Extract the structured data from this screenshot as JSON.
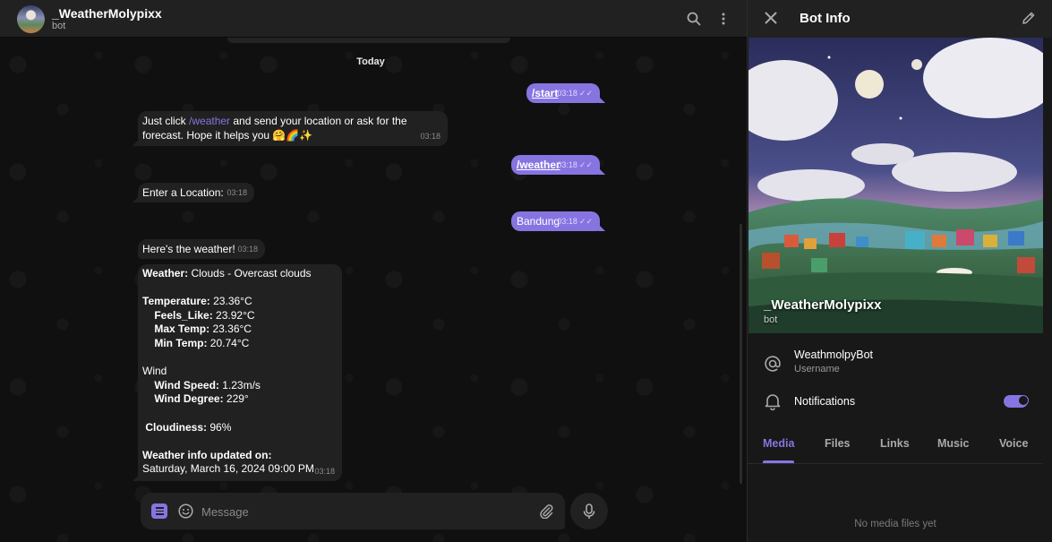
{
  "header": {
    "title": "_WeatherMolypixx",
    "subtitle": "bot",
    "avatar_icon": "bot-avatar",
    "search_icon": "search-icon",
    "more_icon": "more-vertical-icon"
  },
  "chat": {
    "date_label": "Today",
    "messages": [
      {
        "dir": "out",
        "text": "/start",
        "time": "03:18"
      },
      {
        "dir": "in",
        "text_before": "Just click ",
        "link": "/weather",
        "text_after": " and send  your location or ask for the forecast. Hope it helps you 🤗🌈✨",
        "time": "03:18"
      },
      {
        "dir": "out",
        "text": "/weather",
        "time": "03:18"
      },
      {
        "dir": "in",
        "text": "Enter a Location:",
        "time": "03:18"
      },
      {
        "dir": "out",
        "text": "Bandung",
        "time": "03:18"
      },
      {
        "dir": "in",
        "text": "Here's the weather!",
        "time": "03:18"
      }
    ],
    "weather_report": {
      "weather_label": "Weather:",
      "weather_value": " Clouds - Overcast clouds",
      "temperature_label": "Temperature:",
      "temperature_value": " 23.36°C",
      "feels_like_label": "    Feels_Like:",
      "feels_like_value": " 23.92°C",
      "max_temp_label": "    Max Temp:",
      "max_temp_value": " 23.36°C",
      "min_temp_label": "    Min Temp:",
      "min_temp_value": " 20.74°C",
      "wind_label": "Wind",
      "wind_speed_label": "    Wind Speed:",
      "wind_speed_value": " 1.23m/s",
      "wind_degree_label": "    Wind Degree:",
      "wind_degree_value": " 229°",
      "cloudiness_label": " Cloudiness:",
      "cloudiness_value": " 96%",
      "updated_label": "Weather info updated on:",
      "updated_value": "Saturday, March 16, 2024 09:00 PM",
      "time": "03:18"
    }
  },
  "composer": {
    "placeholder": "Message",
    "format_icon": "format-icon",
    "emoji_icon": "emoji-icon",
    "attach_icon": "paperclip-icon",
    "mic_icon": "microphone-icon"
  },
  "panel": {
    "title": "Bot Info",
    "close_icon": "close-icon",
    "edit_icon": "pencil-icon",
    "cover_name": "_WeatherMolypixx",
    "cover_sub": "bot",
    "username_value": "WeathmolpyBot",
    "username_label": "Username",
    "notifications_label": "Notifications",
    "notifications_on": true,
    "tabs": [
      "Media",
      "Files",
      "Links",
      "Music",
      "Voice"
    ],
    "active_tab": "Media",
    "empty_text": "No media files yet"
  },
  "colors": {
    "accent": "#8774e1",
    "bubble_in": "#212121",
    "background": "#0f0f0f"
  }
}
